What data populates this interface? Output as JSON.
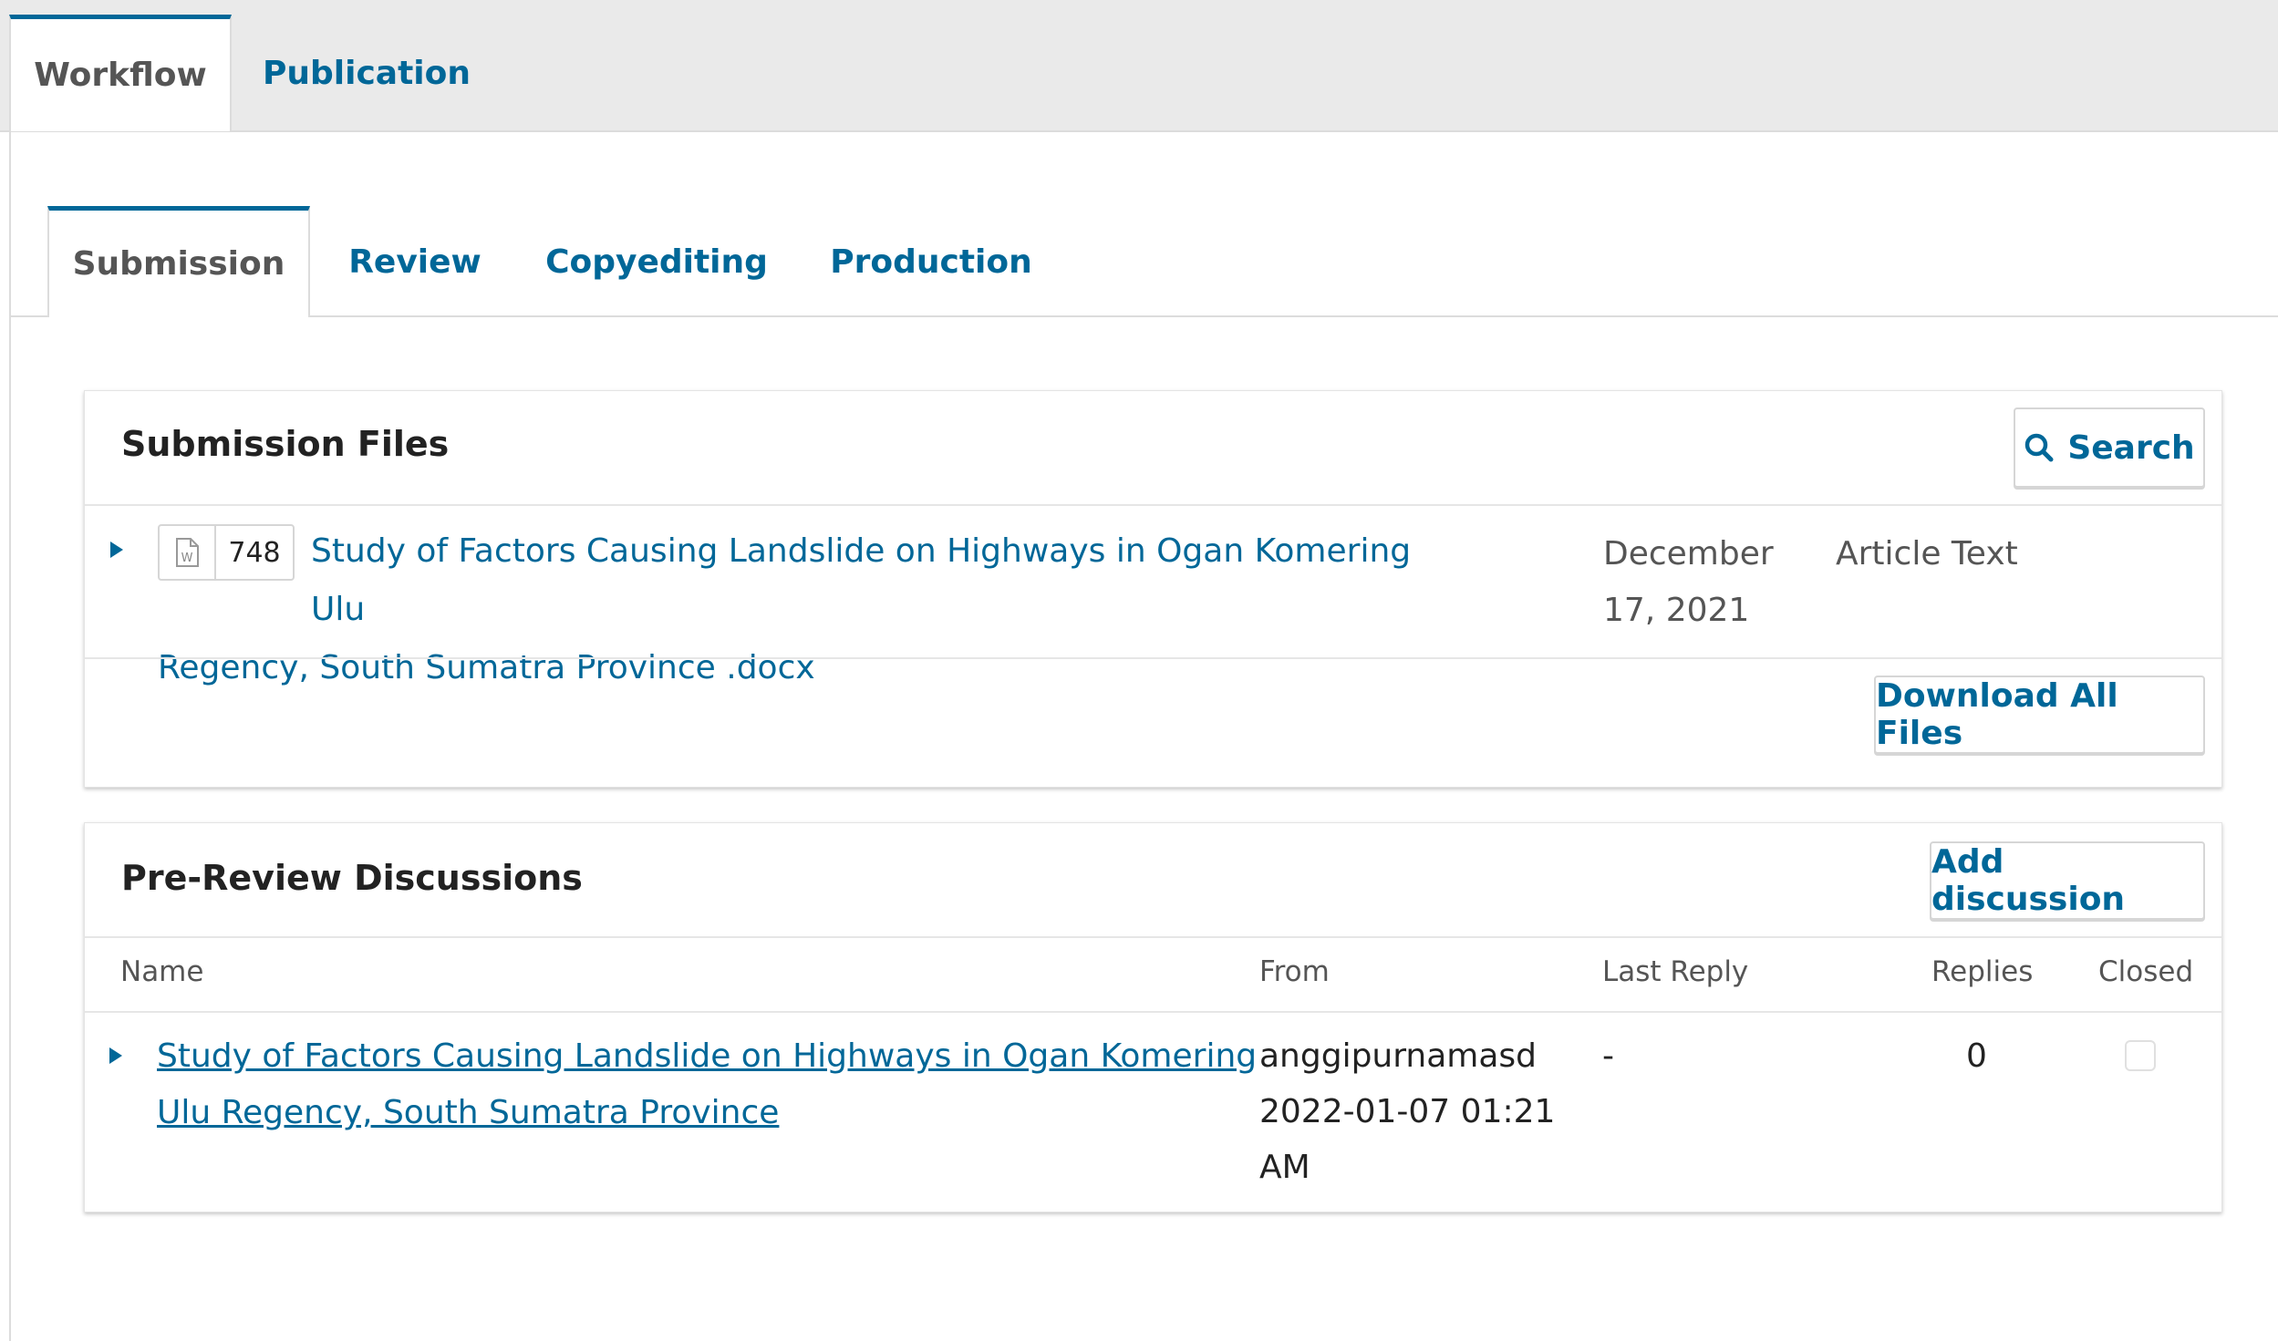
{
  "top_tabs": {
    "workflow": "Workflow",
    "publication": "Publication"
  },
  "stage_tabs": {
    "submission": "Submission",
    "review": "Review",
    "copyediting": "Copyediting",
    "production": "Production"
  },
  "submission_files": {
    "title": "Submission Files",
    "search_label": "Search",
    "file": {
      "icon": "word-document-icon",
      "id": "748",
      "name_line1": "Study of Factors Causing Landslide on Highways in Ogan Komering Ulu",
      "name_line2": "Regency, South Sumatra Province .docx",
      "date_line1": "December",
      "date_line2": "17, 2021",
      "genre": "Article Text"
    },
    "download_all_label": "Download All Files"
  },
  "pre_review": {
    "title": "Pre-Review Discussions",
    "add_label": "Add discussion",
    "columns": {
      "name": "Name",
      "from": "From",
      "last_reply": "Last Reply",
      "replies": "Replies",
      "closed": "Closed"
    },
    "row": {
      "name_line1": "Study of Factors Causing Landslide on Highways in Ogan Komering",
      "name_line2": "Ulu Regency, South Sumatra Province",
      "from_user": "anggipurnamasd",
      "from_date_line1": "2022-01-07 01:21",
      "from_date_line2": "AM",
      "last_reply": "-",
      "replies": "0",
      "closed": false
    }
  },
  "colors": {
    "accent": "#006798",
    "top_bar": "#eaeaea"
  }
}
